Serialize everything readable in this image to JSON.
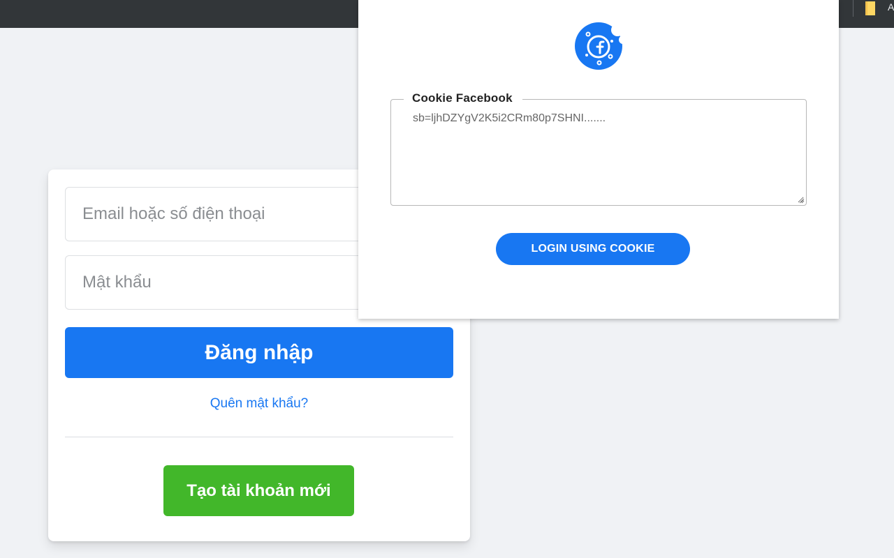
{
  "browser": {
    "bookmark_label": "A"
  },
  "login_card": {
    "email_placeholder": "Email hoặc số điện thoại",
    "password_placeholder": "Mật khẩu",
    "login_label": "Đăng nhập",
    "forgot_label": "Quên mật khẩu?",
    "create_label": "Tạo tài khoản mới"
  },
  "popup": {
    "logo_icon": "cookie-facebook-icon",
    "field_label": "Cookie Facebook",
    "cookie_placeholder": "sb=ljhDZYgV2K5i2CRm80p7SHNI.......",
    "button_label": "LOGIN USING COOKIE"
  },
  "colors": {
    "facebook_blue": "#1877f2",
    "create_green": "#42b72a",
    "page_background": "#f0f2f5"
  }
}
